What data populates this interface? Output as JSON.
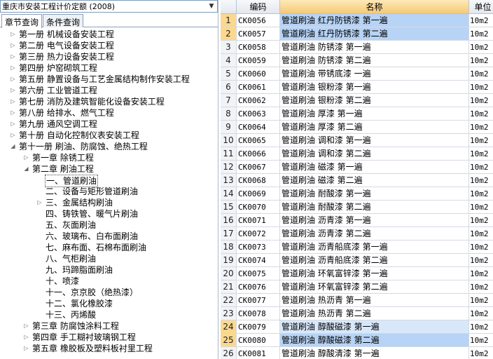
{
  "quota_select": {
    "value": "重庆市安装工程计价定额 (2008)"
  },
  "tabs": [
    "章节查询",
    "条件查询"
  ],
  "tree": [
    {
      "label": "第一册  机械设备安装工程",
      "level": 1,
      "state": "collapsed"
    },
    {
      "label": "第二册  电气设备安装工程",
      "level": 1,
      "state": "collapsed"
    },
    {
      "label": "第三册  热力设备安装工程",
      "level": 1,
      "state": "collapsed"
    },
    {
      "label": "第四册  炉窑砌筑工程",
      "level": 1,
      "state": "collapsed"
    },
    {
      "label": "第五册  静置设备与工艺金属结构制作安装工程",
      "level": 1,
      "state": "collapsed"
    },
    {
      "label": "第六册  工业管道工程",
      "level": 1,
      "state": "collapsed"
    },
    {
      "label": "第七册  消防及建筑智能化设备安装工程",
      "level": 1,
      "state": "collapsed"
    },
    {
      "label": "第八册  给排水、燃气工程",
      "level": 1,
      "state": "collapsed"
    },
    {
      "label": "第九册  通风空调工程",
      "level": 1,
      "state": "collapsed"
    },
    {
      "label": "第十册  自动化控制仪表安装工程",
      "level": 1,
      "state": "collapsed"
    },
    {
      "label": "第十一册  刷油、防腐蚀、绝热工程",
      "level": 1,
      "state": "expanded"
    },
    {
      "label": "第一章  除锈工程",
      "level": 2,
      "state": "collapsed"
    },
    {
      "label": "第二章  刷油工程",
      "level": 2,
      "state": "expanded"
    },
    {
      "label": "一、管道刷油",
      "level": 3,
      "state": "leaf",
      "selected": true
    },
    {
      "label": "二、设备与矩形管道刷油",
      "level": 3,
      "state": "leaf"
    },
    {
      "label": "三、金属结构刷油",
      "level": 3,
      "state": "collapsed"
    },
    {
      "label": "四、铸铁管、暖气片刷油",
      "level": 3,
      "state": "leaf"
    },
    {
      "label": "五、灰面刷油",
      "level": 3,
      "state": "leaf"
    },
    {
      "label": "六、玻璃布、白布面刷油",
      "level": 3,
      "state": "leaf"
    },
    {
      "label": "七、麻布面、石棉布面刷油",
      "level": 3,
      "state": "leaf"
    },
    {
      "label": "八、气柜刷油",
      "level": 3,
      "state": "leaf"
    },
    {
      "label": "九、玛蹄脂面刷油",
      "level": 3,
      "state": "leaf"
    },
    {
      "label": "十、喷漆",
      "level": 3,
      "state": "leaf"
    },
    {
      "label": "十一、京京胶（绝热漆）",
      "level": 3,
      "state": "leaf"
    },
    {
      "label": "十二、氯化橡胶漆",
      "level": 3,
      "state": "leaf"
    },
    {
      "label": "十三、丙烯酸",
      "level": 3,
      "state": "leaf"
    },
    {
      "label": "第三章  防腐蚀涂料工程",
      "level": 2,
      "state": "collapsed"
    },
    {
      "label": "第四章  手工糊衬玻璃钢工程",
      "level": 2,
      "state": "collapsed"
    },
    {
      "label": "第五章  橡胶板及塑料板衬里工程",
      "level": 2,
      "state": "collapsed"
    }
  ],
  "table": {
    "headers": {
      "num": "",
      "code": "编码",
      "name": "名称",
      "unit": "单位"
    },
    "rows": [
      {
        "num": "1",
        "code": "CK0056",
        "name": "管道刷油  红丹防锈漆  第一遍",
        "unit": "10m2",
        "hl": "hl"
      },
      {
        "num": "2",
        "code": "CK0057",
        "name": "管道刷油  红丹防锈漆  第二遍",
        "unit": "10m2",
        "hl": "hl"
      },
      {
        "num": "3",
        "code": "CK0058",
        "name": "管道刷油  防锈漆  第一遍",
        "unit": "10m2"
      },
      {
        "num": "4",
        "code": "CK0059",
        "name": "管道刷油  防锈漆  第二遍",
        "unit": "10m2"
      },
      {
        "num": "5",
        "code": "CK0060",
        "name": "管道刷油  带锈底漆  一遍",
        "unit": "10m2"
      },
      {
        "num": "6",
        "code": "CK0061",
        "name": "管道刷油  银粉漆  第一遍",
        "unit": "10m2"
      },
      {
        "num": "7",
        "code": "CK0062",
        "name": "管道刷油  银粉漆  第二遍",
        "unit": "10m2"
      },
      {
        "num": "8",
        "code": "CK0063",
        "name": "管道刷油  厚漆  第一遍",
        "unit": "10m2"
      },
      {
        "num": "9",
        "code": "CK0064",
        "name": "管道刷油  厚漆  第二遍",
        "unit": "10m2"
      },
      {
        "num": "10",
        "code": "CK0065",
        "name": "管道刷油  调和漆  第一遍",
        "unit": "10m2"
      },
      {
        "num": "11",
        "code": "CK0066",
        "name": "管道刷油  调和漆  第二遍",
        "unit": "10m2"
      },
      {
        "num": "12",
        "code": "CK0067",
        "name": "管道刷油  磁漆  第一遍",
        "unit": "10m2"
      },
      {
        "num": "13",
        "code": "CK0068",
        "name": "管道刷油  磁漆  第二遍",
        "unit": "10m2"
      },
      {
        "num": "14",
        "code": "CK0069",
        "name": "管道刷油  耐酸漆  第一遍",
        "unit": "10m2"
      },
      {
        "num": "15",
        "code": "CK0070",
        "name": "管道刷油  耐酸漆  第二遍",
        "unit": "10m2"
      },
      {
        "num": "16",
        "code": "CK0071",
        "name": "管道刷油  沥青漆  第一遍",
        "unit": "10m2"
      },
      {
        "num": "17",
        "code": "CK0072",
        "name": "管道刷油  沥青漆  第二遍",
        "unit": "10m2"
      },
      {
        "num": "18",
        "code": "CK0073",
        "name": "管道刷油  沥青船底漆  第一遍",
        "unit": "10m2"
      },
      {
        "num": "19",
        "code": "CK0074",
        "name": "管道刷油  沥青船底漆  第二遍",
        "unit": "10m2"
      },
      {
        "num": "20",
        "code": "CK0075",
        "name": "管道刷油  环氧富锌漆  第一遍",
        "unit": "10m2"
      },
      {
        "num": "21",
        "code": "CK0076",
        "name": "管道刷油  环氧富锌漆  第二遍",
        "unit": "10m2"
      },
      {
        "num": "22",
        "code": "CK0077",
        "name": "管道刷油  热沥青  第一遍",
        "unit": "10m2"
      },
      {
        "num": "23",
        "code": "CK0078",
        "name": "管道刷油  热沥青  第二遍",
        "unit": "10m2"
      },
      {
        "num": "24",
        "code": "CK0079",
        "name": "管道刷油  醇酸磁漆  第一遍",
        "unit": "10m2",
        "hl": "hl2"
      },
      {
        "num": "25",
        "code": "CK0080",
        "name": "管道刷油  醇酸磁漆  第二遍",
        "unit": "10m2",
        "hl": "hl"
      },
      {
        "num": "26",
        "code": "CK0081",
        "name": "管道刷油  醇酸清漆  第一遍",
        "unit": "10m2"
      }
    ]
  }
}
